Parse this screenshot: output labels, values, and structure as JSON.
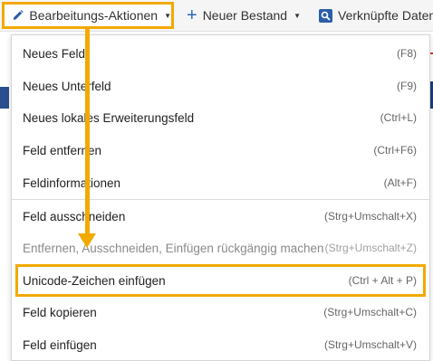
{
  "toolbar": {
    "edit_actions_label": "Bearbeitungs-Aktionen",
    "new_holding_label": "Neuer Bestand",
    "linked_data_label": "Verknüpfte Daten a"
  },
  "menu": {
    "items": [
      {
        "label": "Neues Feld",
        "shortcut": "(F8)"
      },
      {
        "label": "Neues Unterfeld",
        "shortcut": "(F9)"
      },
      {
        "label": "Neues lokales Erweiterungsfeld",
        "shortcut": "(Ctrl+L)"
      },
      {
        "label": "Feld entfernen",
        "shortcut": "(Ctrl+F6)"
      },
      {
        "label": "Feldinformationen",
        "shortcut": "(Alt+F)"
      },
      {
        "label": "Feld ausschneiden",
        "shortcut": "(Strg+Umschalt+X)"
      },
      {
        "label": "Entfernen, Ausschneiden, Einfügen rückgängig machen",
        "shortcut": "(Strg+Umschalt+Z)"
      },
      {
        "label": "Unicode-Zeichen einfügen",
        "shortcut": "(Ctrl + Alt + P)"
      },
      {
        "label": "Feld kopieren",
        "shortcut": "(Strg+Umschalt+C)"
      },
      {
        "label": "Feld einfügen",
        "shortcut": "(Strg+Umschalt+V)"
      }
    ]
  },
  "colors": {
    "highlight": "#f2a900",
    "accent": "#2b6cb0"
  }
}
